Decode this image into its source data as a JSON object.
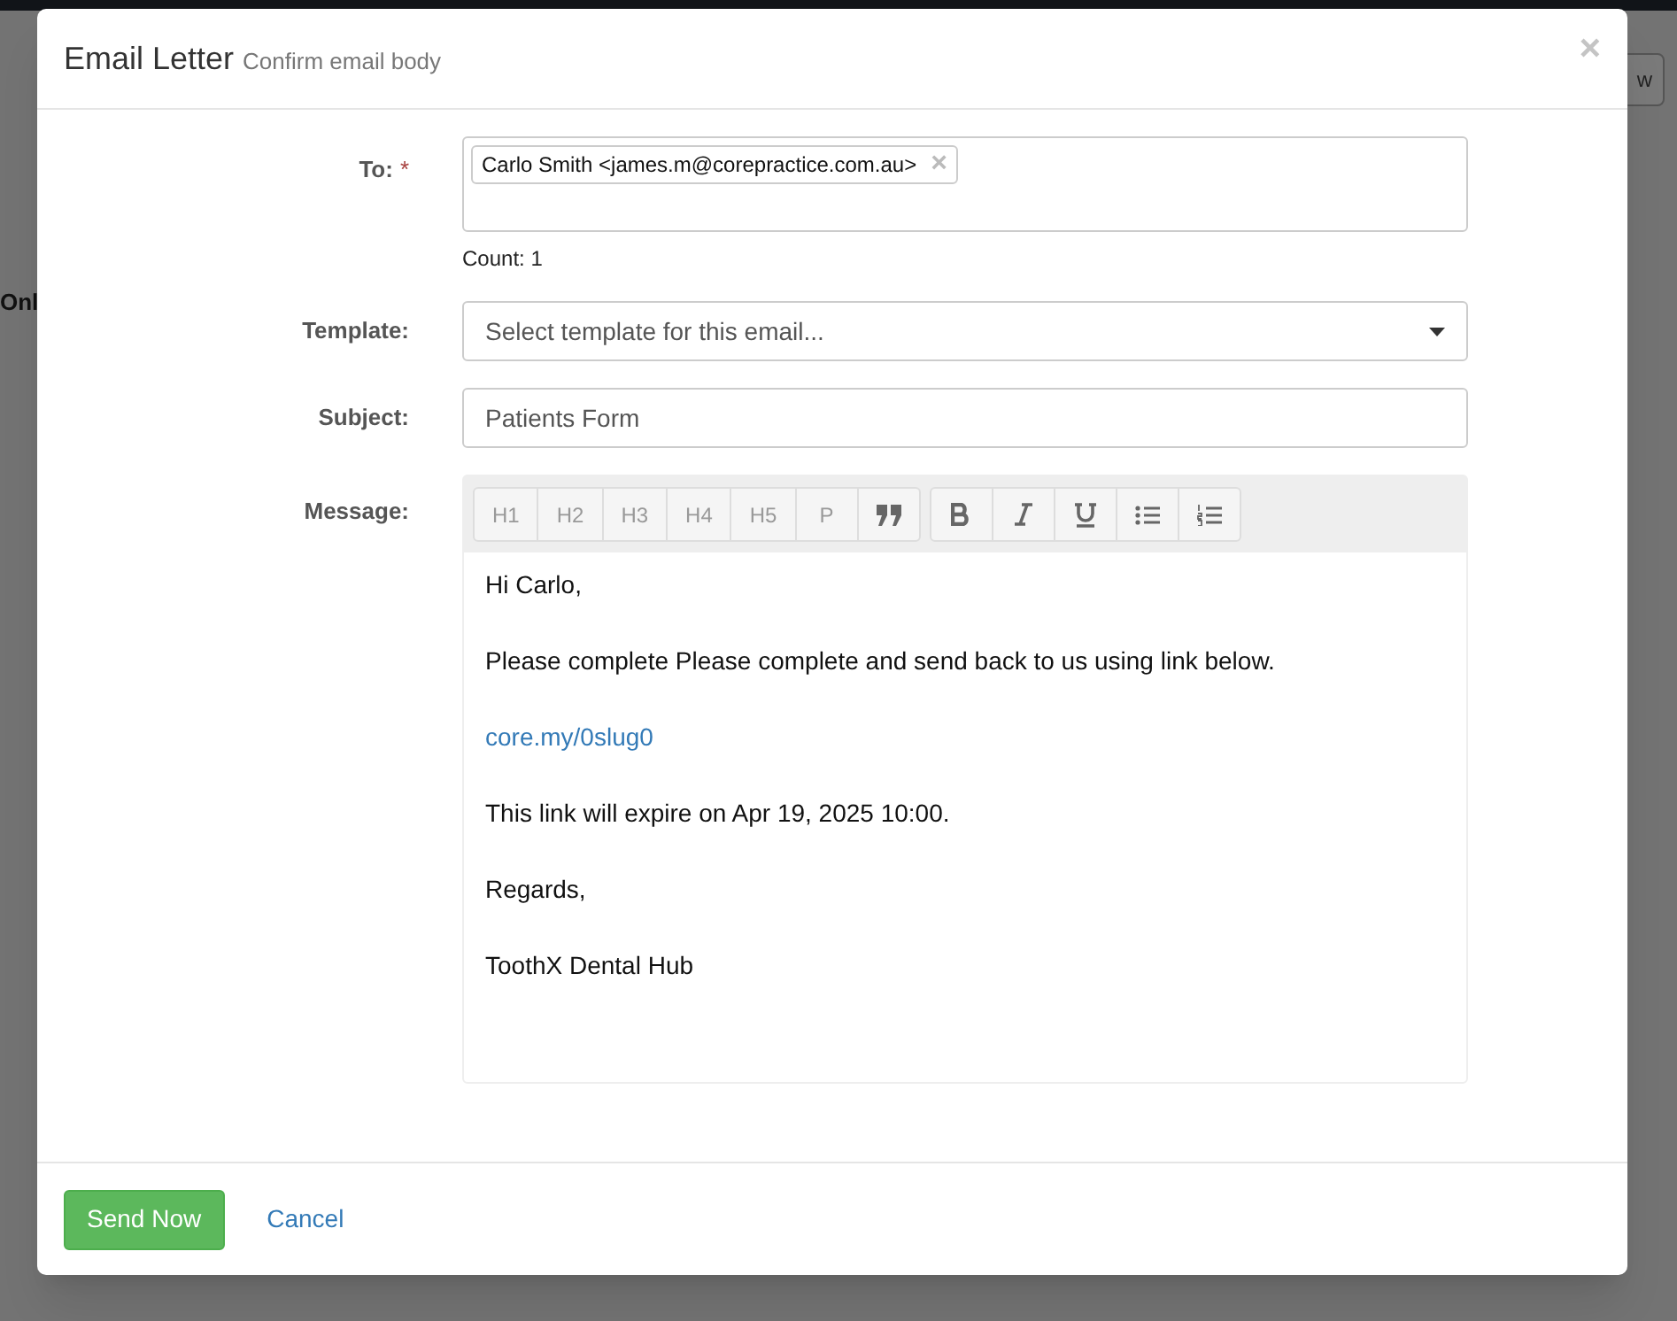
{
  "background": {
    "side_text": "Onl",
    "button_text": "w"
  },
  "modal": {
    "title": "Email Letter",
    "subtitle": "Confirm email body",
    "close": "×"
  },
  "to": {
    "label": "To:",
    "required": "*",
    "recipients": [
      {
        "text": "Carlo Smith <james.m@corepractice.com.au>",
        "remove": "×"
      }
    ],
    "count": "Count: 1"
  },
  "template": {
    "label": "Template:",
    "placeholder": "Select template for this email..."
  },
  "subject": {
    "label": "Subject:",
    "value": "Patients Form"
  },
  "message": {
    "label": "Message:",
    "toolbar": [
      [
        {
          "kind": "text",
          "label": "H1"
        },
        {
          "kind": "text",
          "label": "H2"
        },
        {
          "kind": "text",
          "label": "H3"
        },
        {
          "kind": "text",
          "label": "H4"
        },
        {
          "kind": "text",
          "label": "H5"
        },
        {
          "kind": "text",
          "label": "P"
        },
        {
          "kind": "quote"
        }
      ],
      [
        {
          "kind": "bold"
        },
        {
          "kind": "italic"
        },
        {
          "kind": "underline"
        },
        {
          "kind": "bullets"
        },
        {
          "kind": "numbers"
        }
      ]
    ],
    "body": [
      {
        "kind": "text",
        "text": "Hi Carlo,"
      },
      {
        "kind": "text",
        "text": "Please complete Please complete and send back to us using link below."
      },
      {
        "kind": "link",
        "text": "core.my/0slug0"
      },
      {
        "kind": "text",
        "text": "This link will expire on Apr 19, 2025 10:00."
      },
      {
        "kind": "text",
        "text": "Regards,"
      },
      {
        "kind": "text",
        "text": "ToothX Dental Hub"
      }
    ]
  },
  "buttons": [
    {
      "kind": "primary",
      "label": "Send Now"
    },
    {
      "kind": "link",
      "label": "Cancel"
    }
  ]
}
